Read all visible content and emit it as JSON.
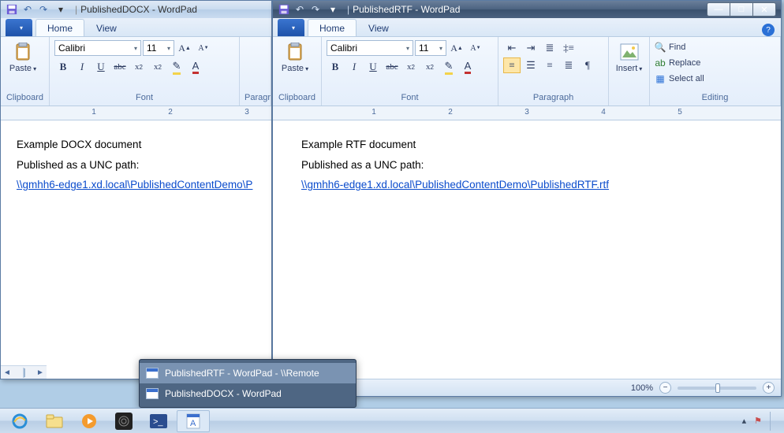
{
  "window_left": {
    "title_doc": "PublishedDOCX - WordPad",
    "tabs": {
      "file": "",
      "home": "Home",
      "view": "View"
    },
    "ribbon_groups": {
      "clipboard": "Clipboard",
      "font": "Font",
      "paragr_trunc": "Paragr"
    },
    "paste_label": "Paste",
    "font_name": "Calibri",
    "font_size": "11",
    "ruler": {
      "n1": "1",
      "n2": "2",
      "n3": "3"
    },
    "doc": {
      "line1": "Example DOCX document",
      "line2": "Published as a UNC path:",
      "link_trunc": "\\\\gmhh6-edge1.xd.local\\PublishedContentDemo\\P"
    }
  },
  "window_right": {
    "title_doc": "PublishedRTF - WordPad",
    "tabs": {
      "home": "Home",
      "view": "View"
    },
    "ribbon_groups": {
      "clipboard": "Clipboard",
      "font": "Font",
      "paragraph": "Paragraph",
      "editing": "Editing"
    },
    "paste_label": "Paste",
    "insert_label": "Insert",
    "font_name": "Calibri",
    "font_size": "11",
    "editing": {
      "find": "Find",
      "replace": "Replace",
      "select_all": "Select all"
    },
    "ruler": {
      "n1": "1",
      "n2": "2",
      "n3": "3",
      "n4": "4",
      "n5": "5"
    },
    "doc": {
      "line1": "Example RTF document",
      "line2": "Published as a UNC path:",
      "link": "\\\\gmhh6-edge1.xd.local\\PublishedContentDemo\\PublishedRTF.rtf"
    },
    "status": {
      "zoom_pct": "100%"
    }
  },
  "thumb_popup": {
    "item1": "PublishedRTF - WordPad - \\\\Remote",
    "item2": "PublishedDOCX - WordPad"
  },
  "fmt": {
    "bold": "B",
    "italic": "I",
    "underline": "U",
    "strike": "abc",
    "sub": "x",
    "sup": "x",
    "grow": "A",
    "shrink": "A",
    "highlight": "A",
    "color": "A",
    "min": "—",
    "max": "□",
    "close": "✕"
  }
}
